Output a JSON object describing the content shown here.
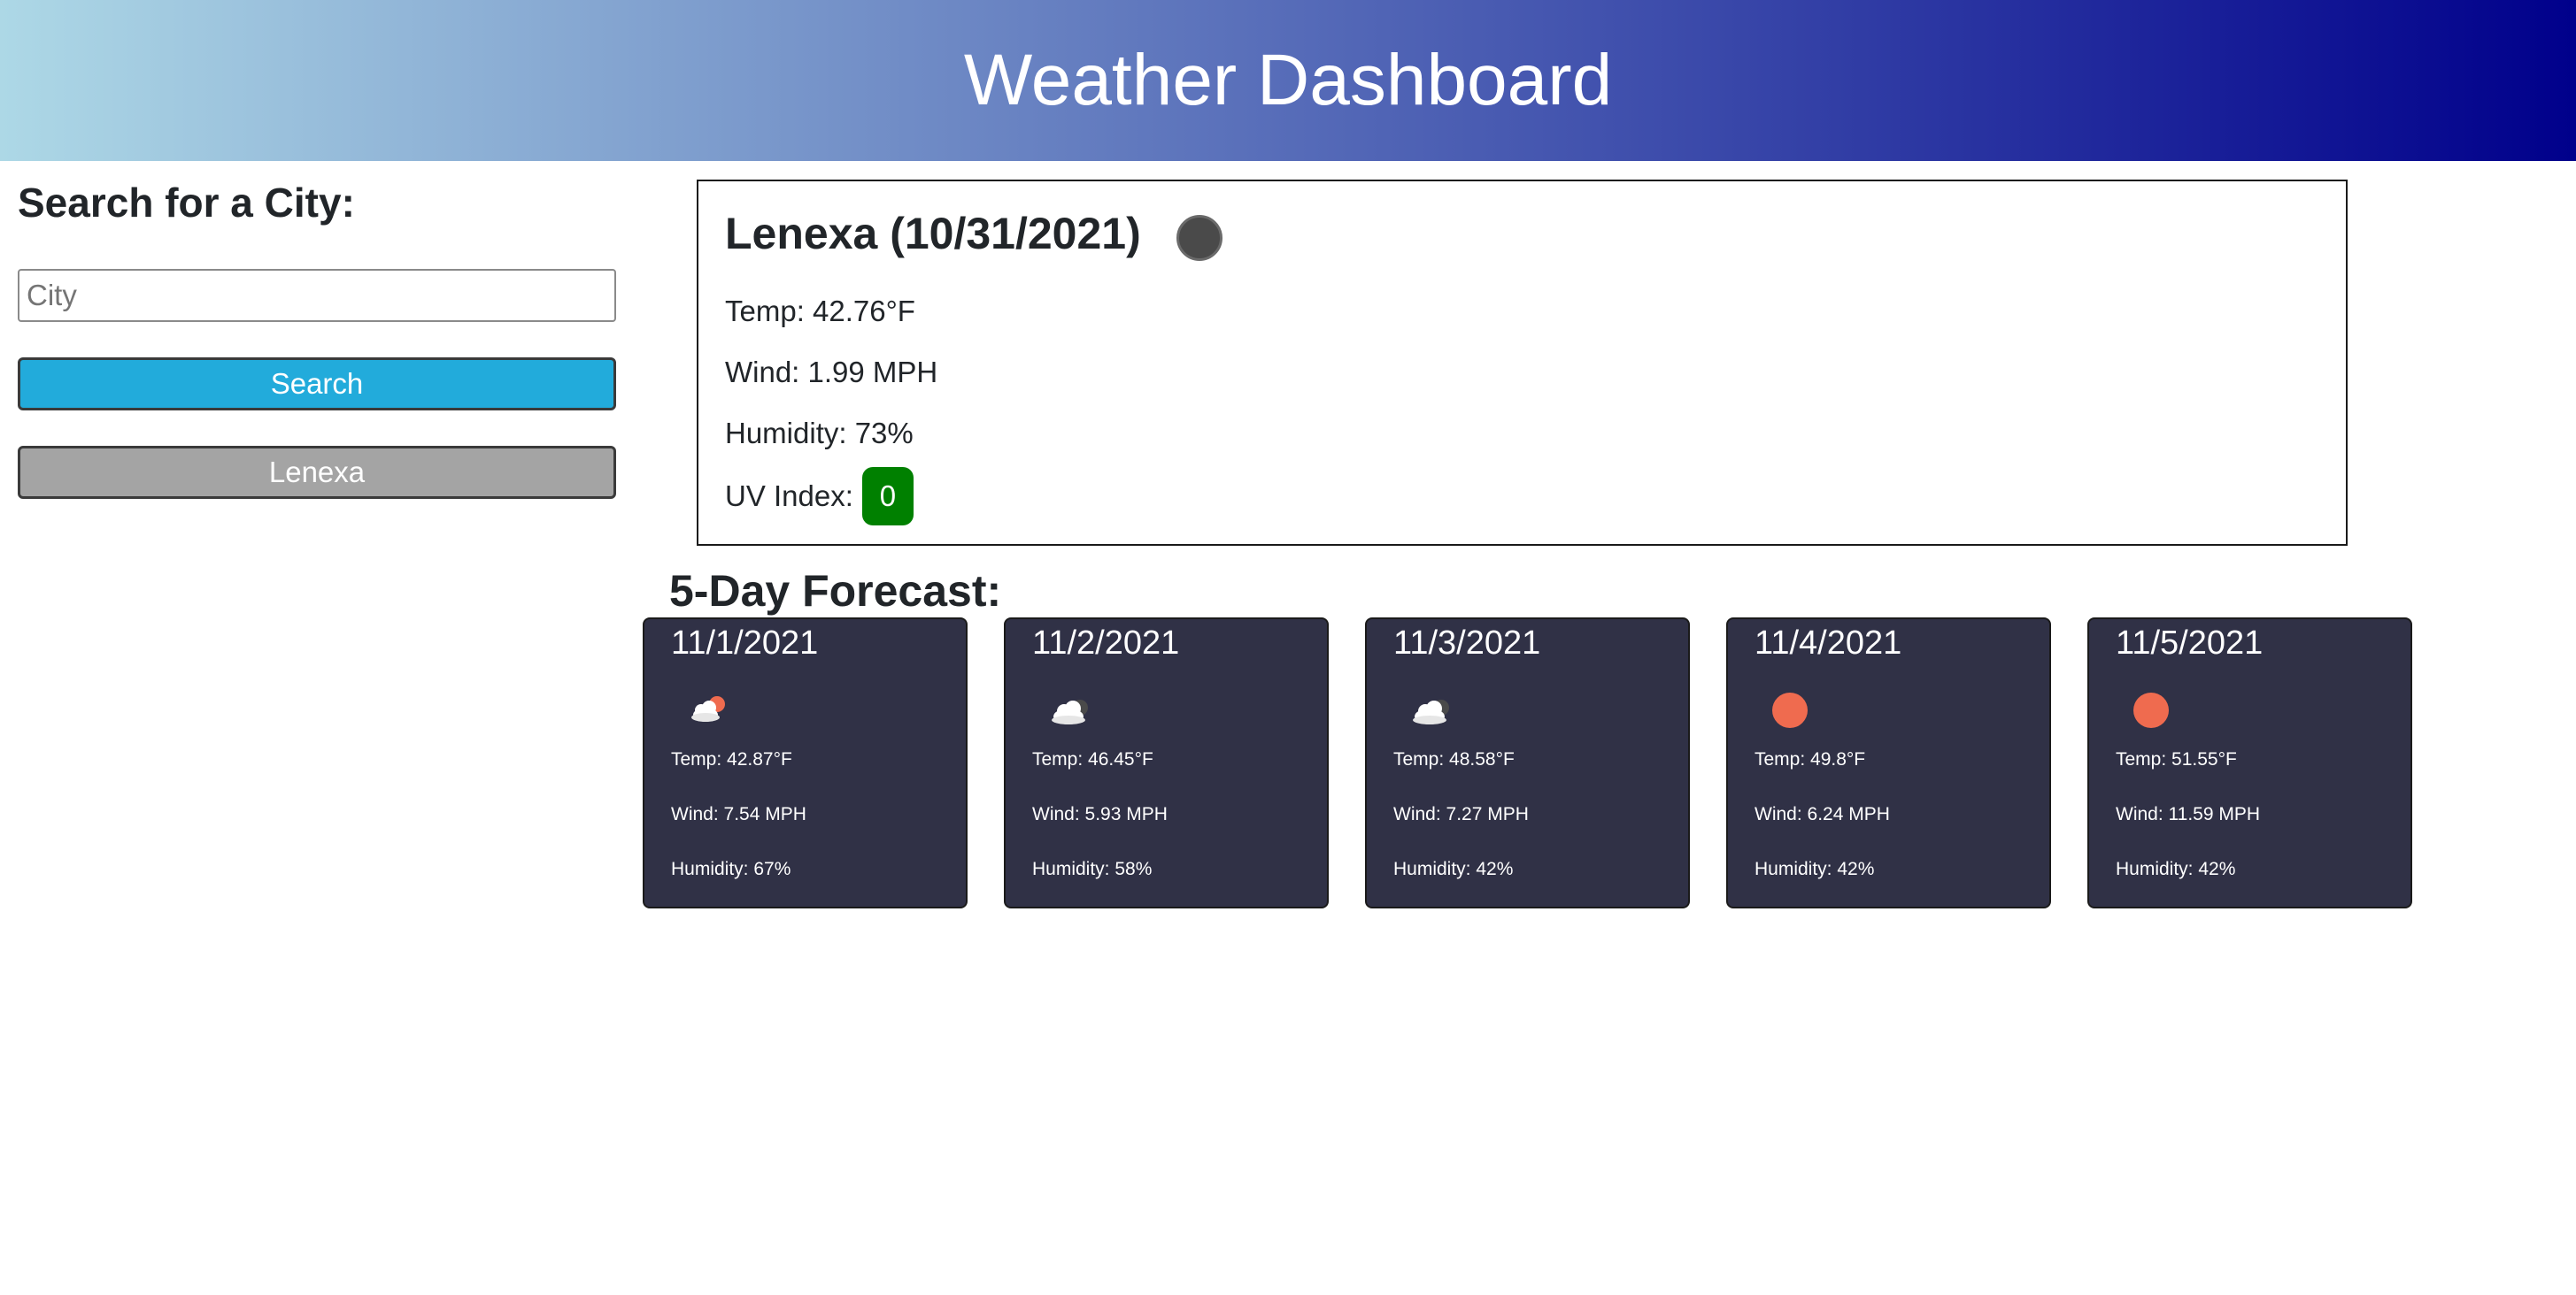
{
  "header": {
    "title": "Weather Dashboard"
  },
  "search": {
    "heading": "Search for a City:",
    "input_value": "",
    "input_placeholder": "City",
    "button_label": "Search",
    "history": [
      "Lenexa"
    ]
  },
  "current": {
    "title": "Lenexa (10/31/2021)",
    "icon": "moon-icon",
    "temp": "Temp: 42.76°F",
    "wind": "Wind: 1.99 MPH",
    "humidity": "Humidity: 73%",
    "uv_label": "UV Index:",
    "uv_value": "0",
    "uv_color": "#008000"
  },
  "forecast": {
    "heading": "5-Day Forecast:",
    "days": [
      {
        "date": "11/1/2021",
        "icon": "cloud-sun-icon",
        "temp": "Temp: 42.87°F",
        "wind": "Wind: 7.54 MPH",
        "humidity": "Humidity: 67%"
      },
      {
        "date": "11/2/2021",
        "icon": "cloud-moon-icon",
        "temp": "Temp: 46.45°F",
        "wind": "Wind: 5.93 MPH",
        "humidity": "Humidity: 58%"
      },
      {
        "date": "11/3/2021",
        "icon": "cloud-moon-icon",
        "temp": "Temp: 48.58°F",
        "wind": "Wind: 7.27 MPH",
        "humidity": "Humidity: 42%"
      },
      {
        "date": "11/4/2021",
        "icon": "sun-icon",
        "temp": "Temp: 49.8°F",
        "wind": "Wind: 6.24 MPH",
        "humidity": "Humidity: 42%"
      },
      {
        "date": "11/5/2021",
        "icon": "sun-icon",
        "temp": "Temp: 51.55°F",
        "wind": "Wind: 11.59 MPH",
        "humidity": "Humidity: 42%"
      }
    ]
  },
  "colors": {
    "header_gradient_start": "#add8e6",
    "header_gradient_end": "#00008b",
    "search_button": "#22abdb",
    "history_button": "#a4a4a4",
    "card_background": "#303146",
    "sun": "#ef6b4f"
  }
}
